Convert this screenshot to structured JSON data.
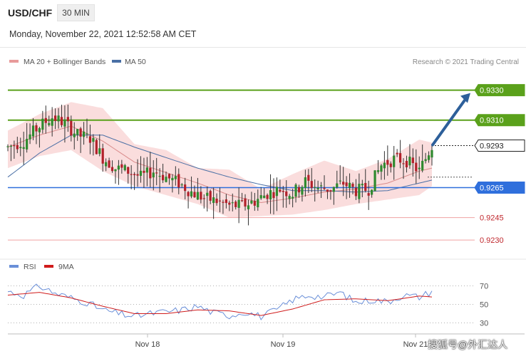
{
  "header": {
    "symbol": "USD/CHF",
    "timeframe": "30 MIN",
    "datetime": "Monday, November 22, 2021 12:52:58 AM CET"
  },
  "legend": {
    "ma20_bb": "MA 20 + Bollinger Bands",
    "ma50": "MA 50",
    "rsi": "RSI",
    "rsi_ma": "9MA"
  },
  "credit": "Research © 2021 Trading Central",
  "watermark": "搜狐号@外汇达人",
  "colors": {
    "bull": "#2f8a2f",
    "bear": "#b2202a",
    "resistance": "#5aa11b",
    "pivot": "#2f6fdc",
    "support": "#d94a4a",
    "ma50": "#4a6fa5",
    "bb": "#f8cfcf",
    "rsi": "#6a8fd8",
    "rsi_ma": "#d01c1c",
    "arrow": "#2d5f9a"
  },
  "chart_data": {
    "type": "candlestick",
    "instrument": "USD/CHF",
    "interval": "30 MIN",
    "x_ticks": [
      "Nov 18",
      "Nov 19",
      "Nov 21"
    ],
    "ylim": [
      0.9222,
      0.9345
    ],
    "levels": [
      {
        "value": 0.933,
        "label": "0.9330",
        "role": "resistance"
      },
      {
        "value": 0.931,
        "label": "0.9310",
        "role": "resistance"
      },
      {
        "value": 0.9293,
        "label": "0.9293",
        "role": "last"
      },
      {
        "value": 0.9265,
        "label": "0.9265",
        "role": "pivot"
      },
      {
        "value": 0.9245,
        "label": "0.9245",
        "role": "support"
      },
      {
        "value": 0.923,
        "label": "0.9230",
        "role": "support"
      }
    ],
    "arrow": {
      "from": 0.9293,
      "to": 0.933
    },
    "price_anchors": [
      [
        0,
        0.9292
      ],
      [
        5,
        0.9296
      ],
      [
        10,
        0.9306
      ],
      [
        14,
        0.9312
      ],
      [
        18,
        0.9308
      ],
      [
        22,
        0.93
      ],
      [
        26,
        0.9298
      ],
      [
        30,
        0.9285
      ],
      [
        34,
        0.9278
      ],
      [
        38,
        0.9276
      ],
      [
        42,
        0.9272
      ],
      [
        46,
        0.9276
      ],
      [
        50,
        0.9272
      ],
      [
        54,
        0.9268
      ],
      [
        58,
        0.9262
      ],
      [
        62,
        0.9258
      ],
      [
        66,
        0.9256
      ],
      [
        70,
        0.9253
      ],
      [
        74,
        0.9253
      ],
      [
        78,
        0.9256
      ],
      [
        82,
        0.9261
      ],
      [
        86,
        0.9264
      ],
      [
        90,
        0.9261
      ],
      [
        94,
        0.9269
      ],
      [
        98,
        0.9265
      ],
      [
        102,
        0.9264
      ],
      [
        106,
        0.9268
      ],
      [
        110,
        0.9263
      ],
      [
        114,
        0.9264
      ],
      [
        118,
        0.928
      ],
      [
        122,
        0.9284
      ],
      [
        126,
        0.9283
      ],
      [
        130,
        0.9276
      ],
      [
        134,
        0.9293
      ]
    ],
    "ma20": [
      [
        0,
        0.9292
      ],
      [
        10,
        0.93
      ],
      [
        20,
        0.9306
      ],
      [
        30,
        0.9296
      ],
      [
        40,
        0.9282
      ],
      [
        50,
        0.9275
      ],
      [
        60,
        0.9268
      ],
      [
        70,
        0.926
      ],
      [
        80,
        0.9255
      ],
      [
        90,
        0.9258
      ],
      [
        100,
        0.9262
      ],
      [
        110,
        0.9264
      ],
      [
        120,
        0.9268
      ],
      [
        130,
        0.9276
      ],
      [
        134,
        0.9278
      ]
    ],
    "ma50": [
      [
        0,
        0.9272
      ],
      [
        10,
        0.9288
      ],
      [
        20,
        0.93
      ],
      [
        30,
        0.93
      ],
      [
        40,
        0.9292
      ],
      [
        50,
        0.9285
      ],
      [
        60,
        0.9278
      ],
      [
        70,
        0.9272
      ],
      [
        80,
        0.9267
      ],
      [
        90,
        0.9263
      ],
      [
        100,
        0.9263
      ],
      [
        110,
        0.9262
      ],
      [
        120,
        0.9263
      ],
      [
        130,
        0.9268
      ],
      [
        134,
        0.927
      ]
    ],
    "bb_upper": [
      [
        0,
        0.9303
      ],
      [
        10,
        0.9314
      ],
      [
        20,
        0.9322
      ],
      [
        30,
        0.9318
      ],
      [
        40,
        0.9294
      ],
      [
        50,
        0.929
      ],
      [
        60,
        0.9278
      ],
      [
        70,
        0.9277
      ],
      [
        80,
        0.9264
      ],
      [
        90,
        0.9274
      ],
      [
        100,
        0.9283
      ],
      [
        110,
        0.9276
      ],
      [
        120,
        0.9284
      ],
      [
        130,
        0.9297
      ],
      [
        134,
        0.9295
      ]
    ],
    "bb_lower": [
      [
        0,
        0.9278
      ],
      [
        10,
        0.9286
      ],
      [
        20,
        0.929
      ],
      [
        30,
        0.9276
      ],
      [
        40,
        0.9266
      ],
      [
        50,
        0.926
      ],
      [
        60,
        0.9254
      ],
      [
        70,
        0.9245
      ],
      [
        80,
        0.9246
      ],
      [
        90,
        0.9247
      ],
      [
        100,
        0.925
      ],
      [
        110,
        0.9254
      ],
      [
        120,
        0.9257
      ],
      [
        130,
        0.926
      ],
      [
        134,
        0.9266
      ]
    ],
    "rsi": {
      "ylim": [
        25,
        75
      ],
      "ticks": [
        70,
        50,
        30
      ],
      "rsi_anchors": [
        [
          0,
          64
        ],
        [
          5,
          60
        ],
        [
          10,
          70
        ],
        [
          15,
          62
        ],
        [
          20,
          57
        ],
        [
          25,
          52
        ],
        [
          30,
          44
        ],
        [
          35,
          40
        ],
        [
          40,
          37
        ],
        [
          45,
          40
        ],
        [
          50,
          42
        ],
        [
          55,
          44
        ],
        [
          60,
          48
        ],
        [
          65,
          41
        ],
        [
          70,
          38
        ],
        [
          75,
          42
        ],
        [
          80,
          37
        ],
        [
          85,
          44
        ],
        [
          90,
          55
        ],
        [
          95,
          60
        ],
        [
          100,
          58
        ],
        [
          105,
          63
        ],
        [
          110,
          52
        ],
        [
          115,
          55
        ],
        [
          120,
          53
        ],
        [
          125,
          60
        ],
        [
          130,
          58
        ],
        [
          134,
          64
        ]
      ],
      "ma_anchors": [
        [
          0,
          60
        ],
        [
          10,
          63
        ],
        [
          20,
          57
        ],
        [
          30,
          48
        ],
        [
          40,
          40
        ],
        [
          50,
          40
        ],
        [
          60,
          44
        ],
        [
          70,
          43
        ],
        [
          80,
          38
        ],
        [
          90,
          45
        ],
        [
          100,
          55
        ],
        [
          110,
          56
        ],
        [
          120,
          54
        ],
        [
          130,
          59
        ],
        [
          134,
          58
        ]
      ]
    }
  }
}
